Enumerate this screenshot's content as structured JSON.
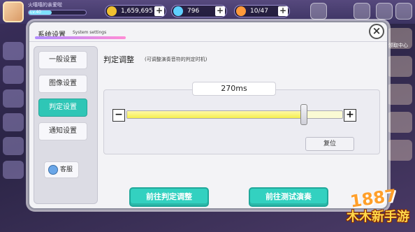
{
  "hud": {
    "player_name": "火嘻嘻的亲爱啦",
    "level_text": "Lv.40",
    "resources": [
      {
        "name": "coins",
        "value": "1,659,695",
        "icon": "coin-icon",
        "color": "#f0c030"
      },
      {
        "name": "diamonds",
        "value": "796",
        "icon": "diamond-icon",
        "color": "#5fd0ff"
      },
      {
        "name": "energy",
        "value": "10/47",
        "icon": "energy-icon",
        "color": "#ff9a3a"
      }
    ],
    "side_label": "领取中心"
  },
  "dialog": {
    "title": "系统设置",
    "subtitle": "System settings",
    "close_symbol": "×",
    "menu": [
      {
        "label": "一般设置",
        "active": false
      },
      {
        "label": "图像设置",
        "active": false
      },
      {
        "label": "判定设置",
        "active": true
      },
      {
        "label": "通知设置",
        "active": false
      }
    ],
    "service_label": "客服",
    "section_title": "判定调整",
    "section_note": "(可调整演奏音符的判定时机)",
    "judgment": {
      "value_text": "270ms",
      "minus_symbol": "−",
      "plus_symbol": "+",
      "slider_fraction": 0.82,
      "reset_label": "复位"
    },
    "actions": {
      "goto_adjust_label": "前往判定调整",
      "goto_test_label": "前往测试演奏"
    }
  },
  "watermark": {
    "number": "1887",
    "text": "木木新手游"
  },
  "colors": {
    "accent_teal": "#33d1c0",
    "slider_yellow": "#f4ee50"
  }
}
